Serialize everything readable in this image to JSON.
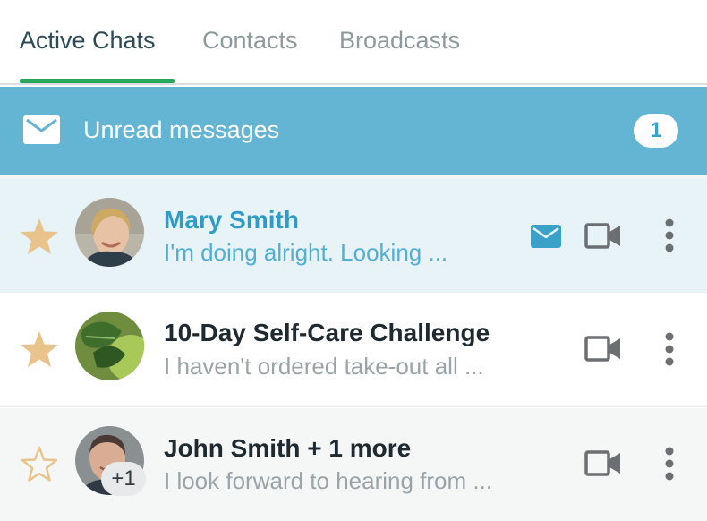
{
  "tabs": [
    {
      "label": "Active Chats",
      "active": true
    },
    {
      "label": "Contacts",
      "active": false
    },
    {
      "label": "Broadcasts",
      "active": false
    }
  ],
  "unread": {
    "label": "Unread messages",
    "count": "1",
    "icon": "envelope-icon"
  },
  "chats": [
    {
      "name": "Mary Smith",
      "preview": "I'm doing alright. Looking ...",
      "starred": true,
      "unread": true,
      "icons": [
        "unread-mail-icon",
        "video-camera-icon",
        "more-vertical-icon"
      ]
    },
    {
      "name": "10-Day Self-Care Challenge",
      "preview": "I haven't ordered take-out all ...",
      "starred": true,
      "unread": false,
      "icons": [
        "video-camera-icon",
        "more-vertical-icon"
      ]
    },
    {
      "name": "John Smith + 1 more",
      "preview": "I look forward to hearing from ...",
      "starred": false,
      "unread": false,
      "extra_participants": "+1",
      "icons": [
        "video-camera-icon",
        "more-vertical-icon"
      ]
    }
  ],
  "colors": {
    "accent_green": "#27a65a",
    "banner_blue": "#63b5d3",
    "unread_row": "#e8f3f8",
    "star_gold": "#e8c48c",
    "link_blue": "#2f9cc7"
  }
}
